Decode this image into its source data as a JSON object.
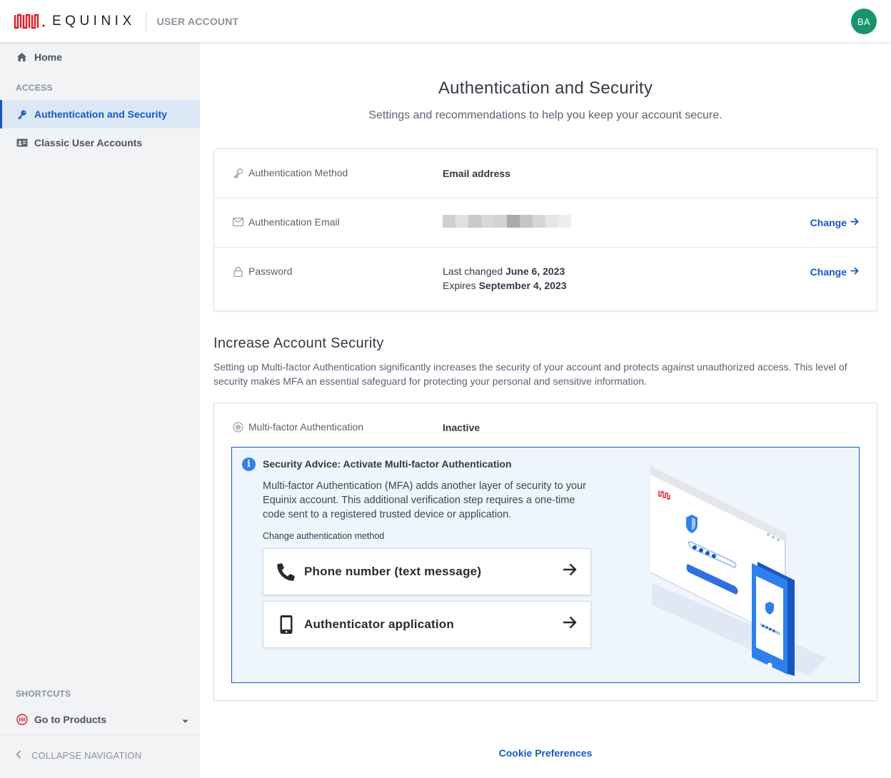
{
  "header": {
    "brand": "EQUINIX",
    "app_name": "USER ACCOUNT",
    "avatar_initials": "BA"
  },
  "sidebar": {
    "home": "Home",
    "access_section": "ACCESS",
    "items": [
      {
        "label": "Authentication and Security",
        "active": true,
        "icon": "key-icon"
      },
      {
        "label": "Classic User Accounts",
        "active": false,
        "icon": "id-card-icon"
      }
    ],
    "shortcuts_section": "SHORTCUTS",
    "go_to_products": "Go to Products",
    "collapse": "COLLAPSE NAVIGATION"
  },
  "main": {
    "title": "Authentication and Security",
    "subtitle": "Settings and recommendations to help you keep your account secure.",
    "auth_card": {
      "method_label": "Authentication Method",
      "method_value": "Email address",
      "email_label": "Authentication Email",
      "change_label": "Change",
      "password_label": "Password",
      "password_changed_prefix": "Last changed",
      "password_changed_date": "June 6, 2023",
      "password_expires_prefix": "Expires",
      "password_expires_date": "September 4, 2023"
    },
    "increase_security": {
      "title": "Increase Account Security",
      "description": "Setting up Multi-factor Authentication significantly increases the security of your account and protects against unauthorized access. This level of security makes MFA an essential safeguard for protecting your personal and sensitive information."
    },
    "mfa_card": {
      "label": "Multi-factor Authentication",
      "status": "Inactive",
      "advice_title": "Security Advice: Activate Multi-factor Authentication",
      "advice_body": "Multi-factor Authentication (MFA) adds another layer of security to your Equinix account. This additional verification step requires a one-time code sent to a registered trusted device or application.",
      "change_method_label": "Change authentication method",
      "methods": [
        {
          "label": "Phone number (text message)",
          "icon": "phone-icon"
        },
        {
          "label": "Authenticator application",
          "icon": "mobile-device-icon"
        }
      ]
    },
    "footer_link": "Cookie Preferences"
  },
  "colors": {
    "brand_red": "#e31b23",
    "accent_blue": "#1757c2",
    "avatar_green": "#17946e"
  }
}
